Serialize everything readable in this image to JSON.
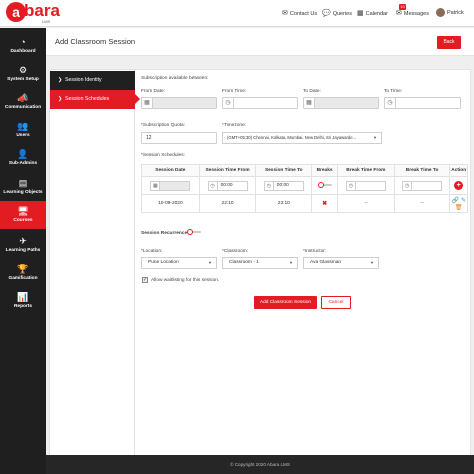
{
  "brand": {
    "logo_letter": "a",
    "name": "bara",
    "sub": "LMS"
  },
  "header": {
    "contact": "Contact Us",
    "queries": "Queries",
    "calendar": "Calendar",
    "messages": "Messages",
    "messages_count": "10",
    "user": "Patrick"
  },
  "sidebar": {
    "items": [
      {
        "label": "Dashboard",
        "icon": "dashboard-icon",
        "glyph": "◔"
      },
      {
        "label": "System Setup",
        "icon": "gear-icon",
        "glyph": "⚙"
      },
      {
        "label": "Communication",
        "icon": "megaphone-icon",
        "glyph": "📣"
      },
      {
        "label": "Users",
        "icon": "users-icon",
        "glyph": "👥"
      },
      {
        "label": "Sub-Admins",
        "icon": "sub-admins-icon",
        "glyph": "👤"
      },
      {
        "label": "Learning Objects",
        "icon": "learning-objects-icon",
        "glyph": "▤"
      },
      {
        "label": "Courses",
        "icon": "courses-icon",
        "glyph": "🖥"
      },
      {
        "label": "Learning Paths",
        "icon": "learning-paths-icon",
        "glyph": "✈"
      },
      {
        "label": "Gamification",
        "icon": "trophy-icon",
        "glyph": "🏆"
      },
      {
        "label": "Reports",
        "icon": "reports-icon",
        "glyph": "📊"
      }
    ]
  },
  "page": {
    "title": "Add Classroom Session",
    "back_label": "Back"
  },
  "tabs": [
    {
      "label": "Session Identity"
    },
    {
      "label": "Session Schedules"
    }
  ],
  "form": {
    "available_label": "Subscription available between:",
    "from_date_label": "From Date:",
    "from_time_label": "From Time:",
    "to_date_label": "To Date:",
    "to_time_label": "To Time:",
    "quota_label": "*Subscription Quota:",
    "quota_value": "12",
    "timezone_label": "*Timezone:",
    "timezone_value": "(GMT+05:30) Chennai, Kolkata, Mumbai, New Delhi, Sri Jayawarde...",
    "schedules_label": "*Session Schedules:",
    "table": {
      "headers": [
        "Session Date",
        "Session Time From",
        "Session Time To",
        "Breaks",
        "Break Time From",
        "Break Time To",
        "Action"
      ],
      "input_row": {
        "time_from": "00:00",
        "time_to": "00:00"
      },
      "row": {
        "date": "10-09-2020",
        "time_from": "22:10",
        "time_to": "23:10",
        "breaks": "✖",
        "break_from": "--",
        "break_to": "--"
      }
    },
    "recurrence_label": "Session Recurrence",
    "location_label": "*Location:",
    "location_value": "Pune Location",
    "classroom_label": "*Classroom:",
    "classroom_value": "Classroom - 1",
    "instructor_label": "*Instructor:",
    "instructor_value": "Ava Glassman",
    "waitlist_label": "Allow waitlisting for this session.",
    "submit_label": "Add Classroom Session",
    "cancel_label": "Cancel"
  },
  "footer": "© Copyright 2020 Abara LMS",
  "colors": {
    "accent": "#e31b23",
    "sidebar": "#1f1f1f",
    "footer": "#262626"
  }
}
